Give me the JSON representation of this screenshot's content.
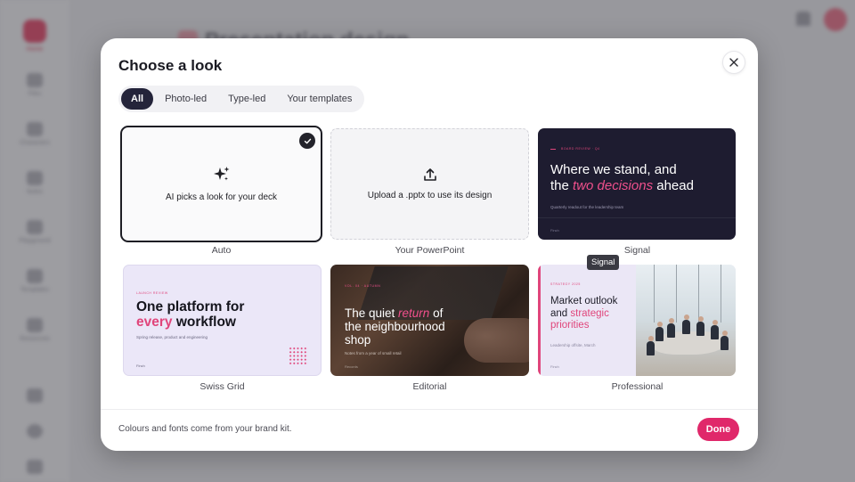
{
  "background_app": {
    "title": "Presentation design",
    "nav": [
      "Home",
      "Files",
      "Characters",
      "Notes",
      "Playground",
      "Templates",
      "Resources"
    ]
  },
  "modal": {
    "title": "Choose a look",
    "close_icon": "close-icon",
    "tabs": [
      {
        "label": "All",
        "active": true
      },
      {
        "label": "Photo-led",
        "active": false
      },
      {
        "label": "Type-led",
        "active": false
      },
      {
        "label": "Your templates",
        "active": false
      }
    ],
    "options": {
      "auto": {
        "card_text": "AI picks a look for your deck",
        "caption": "Auto",
        "selected": true,
        "icon": "sparkles-icon"
      },
      "powerpoint": {
        "card_text": "Upload a .pptx to use its design",
        "caption": "Your PowerPoint",
        "icon": "upload-icon"
      },
      "signal": {
        "caption": "Signal",
        "kicker": "BOARD REVIEW · Q4",
        "heading_1": "Where we stand, and",
        "heading_2": "the ",
        "heading_em": "two decisions",
        "heading_3": " ahead",
        "sub": "Quarterly readout for the leadership team",
        "foot": "Finch"
      },
      "swiss": {
        "caption": "Swiss Grid",
        "kicker": "LAUNCH REVIEW",
        "heading_1": "One platform for",
        "heading_em": "every",
        "heading_2": " workflow",
        "sub": "Spring release, product and engineering",
        "foot": "Finch"
      },
      "editorial": {
        "caption": "Editorial",
        "kicker": "VOL. 04 · AUTUMN",
        "heading_1": "The quiet ",
        "heading_em": "return",
        "heading_2": " of",
        "heading_3": "the neighbourhood",
        "heading_4": "shop",
        "sub": "Notes from a year of small retail",
        "foot": "Records"
      },
      "professional": {
        "caption": "Professional",
        "kicker": "STRATEGY 2025",
        "heading_1": "Market outlook",
        "heading_2": "and ",
        "heading_em": "strategic",
        "heading_3": "priorities",
        "sub": "Leadership offsite, March",
        "foot": "Finch"
      }
    },
    "tooltip": "Signal",
    "footer_note": "Colours and fonts come from your brand kit.",
    "done_label": "Done"
  },
  "colors": {
    "accent": "#e0286a",
    "dark": "#24243a"
  }
}
